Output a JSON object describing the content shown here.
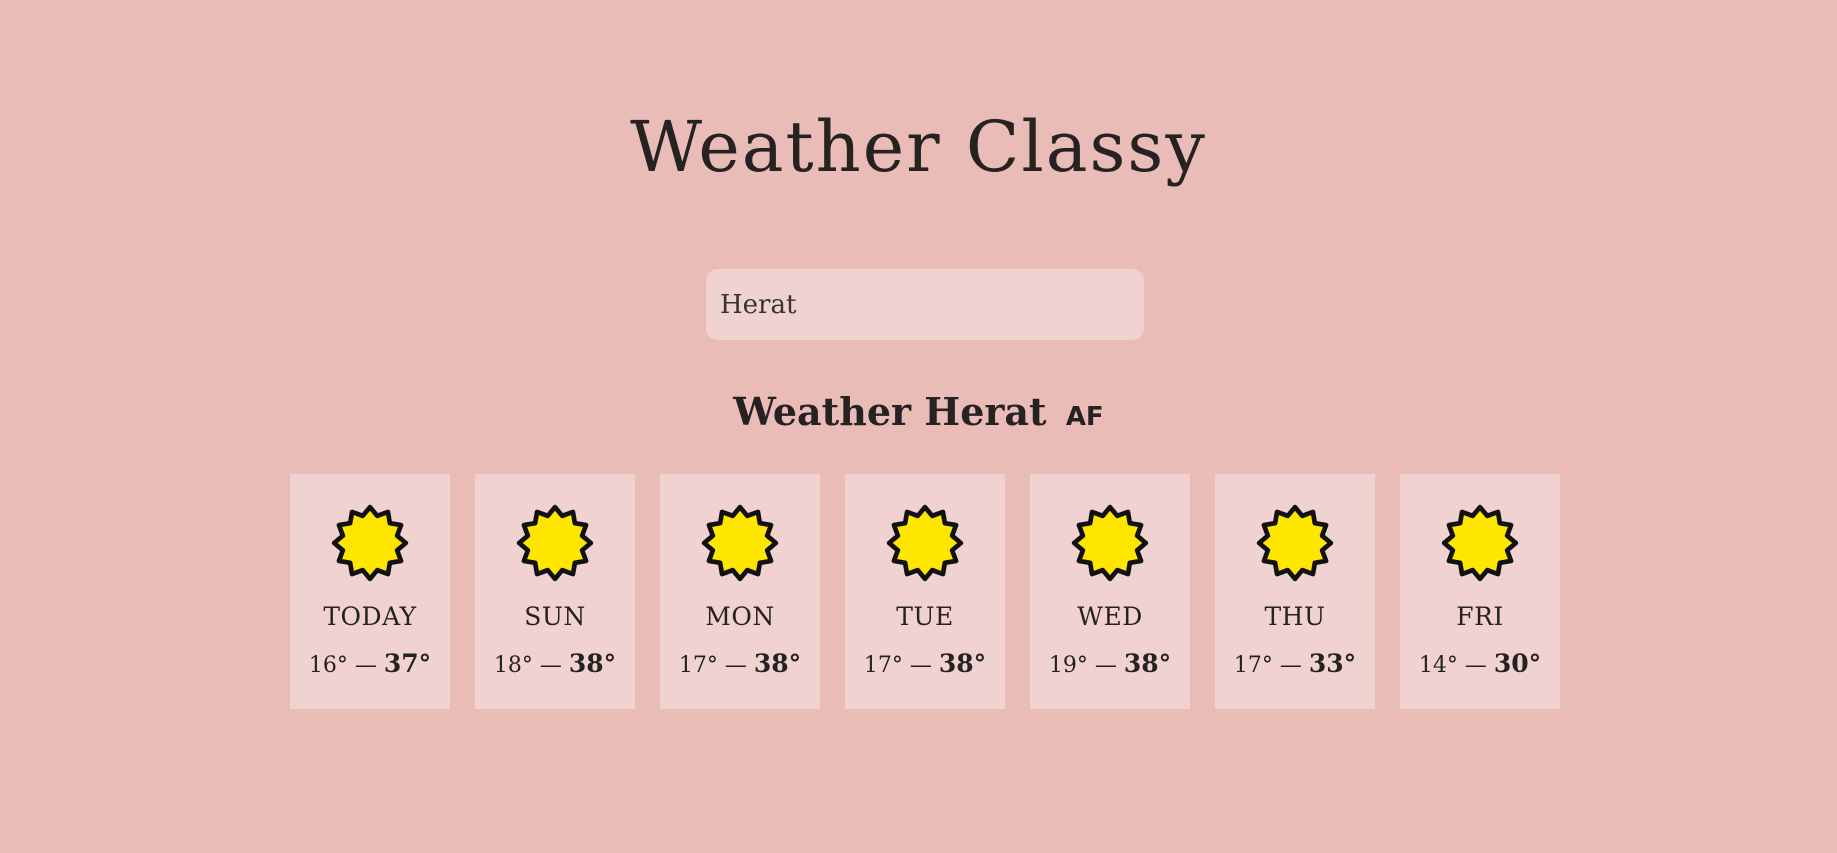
{
  "app": {
    "title": "Weather Classy"
  },
  "search": {
    "value": "Herat"
  },
  "location": {
    "prefix": "Weather",
    "city": "Herat",
    "country": "AF"
  },
  "forecast": [
    {
      "day": "TODAY",
      "min": "16°",
      "max": "37°",
      "icon": "sun-icon"
    },
    {
      "day": "SUN",
      "min": "18°",
      "max": "38°",
      "icon": "sun-icon"
    },
    {
      "day": "MON",
      "min": "17°",
      "max": "38°",
      "icon": "sun-icon"
    },
    {
      "day": "TUE",
      "min": "17°",
      "max": "38°",
      "icon": "sun-icon"
    },
    {
      "day": "WED",
      "min": "19°",
      "max": "38°",
      "icon": "sun-icon"
    },
    {
      "day": "THU",
      "min": "17°",
      "max": "33°",
      "icon": "sun-icon"
    },
    {
      "day": "FRI",
      "min": "14°",
      "max": "30°",
      "icon": "sun-icon"
    }
  ],
  "separator": "—",
  "colors": {
    "background": "#eabcb8",
    "card": "#f0d3d0",
    "text": "#262222",
    "sun_fill": "#ffe600",
    "sun_outline": "#111111"
  }
}
